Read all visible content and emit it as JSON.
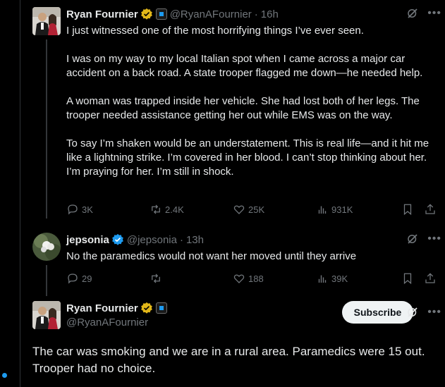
{
  "tweets": [
    {
      "name": "Ryan Fournier",
      "handle": "@RyanAFournier",
      "separator": "·",
      "time": "16h",
      "paragraphs": [
        "I just witnessed one of the most horrifying things I’ve ever seen.",
        "I was on my way to my local Italian spot when I came across a major car accident on a back road. A state trooper flagged me down—he needed help.",
        "A woman was trapped inside her vehicle. She had lost both of her legs. The trooper needed assistance getting her out while EMS was on the way.",
        "To say I’m shaken would be an understatement. This is real life—and it hit me like a lightning strike. I’m covered in her blood. I can’t stop thinking about her. I’m praying for her. I’m still in shock."
      ],
      "stats": {
        "replies": "3K",
        "reposts": "2.4K",
        "likes": "25K",
        "views": "931K"
      },
      "badge_color": "#e2b719"
    },
    {
      "name": "jepsonia",
      "handle": "@jepsonia",
      "separator": "·",
      "time": "13h",
      "text": "No the paramedics would not want her moved until they arrive",
      "stats": {
        "replies": "29",
        "reposts": "",
        "likes": "188",
        "views": "39K"
      },
      "badge_color": "#1d9bf0"
    },
    {
      "name": "Ryan Fournier",
      "handle": "@RyanAFournier",
      "subscribe_label": "Subscribe",
      "text": "The car was smoking and we are in a rural area. Paramedics were 15 out. Trooper had no choice.",
      "badge_color": "#e2b719"
    }
  ],
  "icons": [
    "grok-icon",
    "more-icon",
    "reply-icon",
    "repost-icon",
    "like-icon",
    "views-icon",
    "bookmark-icon",
    "share-icon",
    "gold-check-icon",
    "blue-check-icon",
    "affiliate-badge-icon"
  ]
}
